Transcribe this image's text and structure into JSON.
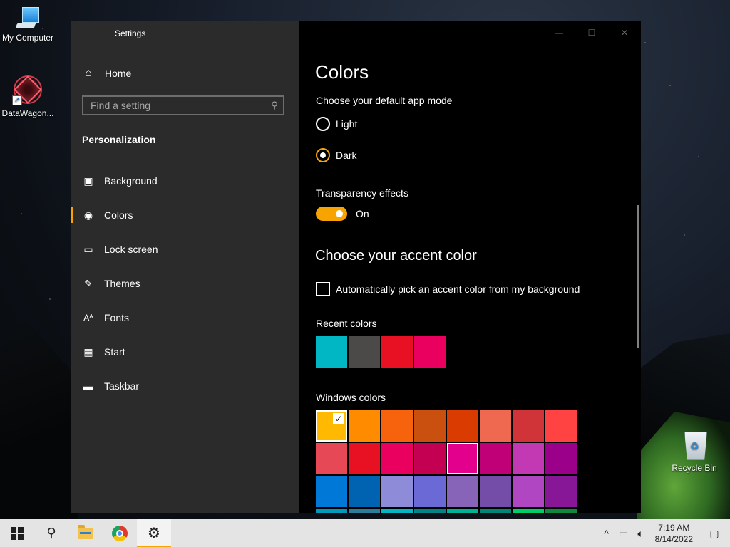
{
  "desktop": {
    "icons": [
      {
        "label": "My Computer"
      },
      {
        "label": "DataWagon..."
      },
      {
        "label": "Recycle Bin"
      }
    ]
  },
  "window": {
    "title": "Settings",
    "controls": {
      "minimize": "—",
      "maximize": "☐",
      "close": "✕"
    }
  },
  "sidebar": {
    "home": {
      "label": "Home",
      "icon": "home-icon"
    },
    "search": {
      "placeholder": "Find a setting",
      "icon": "search-icon"
    },
    "section_title": "Personalization",
    "items": [
      {
        "label": "Background",
        "icon": "picture-icon",
        "active": false
      },
      {
        "label": "Colors",
        "icon": "palette-icon",
        "active": true
      },
      {
        "label": "Lock screen",
        "icon": "lock-screen-icon",
        "active": false
      },
      {
        "label": "Themes",
        "icon": "brush-icon",
        "active": false
      },
      {
        "label": "Fonts",
        "icon": "font-icon",
        "active": false
      },
      {
        "label": "Start",
        "icon": "start-icon",
        "active": false
      },
      {
        "label": "Taskbar",
        "icon": "taskbar-icon",
        "active": false
      }
    ]
  },
  "content": {
    "title": "Colors",
    "app_mode": {
      "heading": "Choose your default app mode",
      "options": [
        {
          "label": "Light",
          "selected": false
        },
        {
          "label": "Dark",
          "selected": true
        }
      ]
    },
    "transparency": {
      "heading": "Transparency effects",
      "state_label": "On",
      "on": true
    },
    "accent": {
      "heading": "Choose your accent color",
      "auto_checkbox_label": "Automatically pick an accent color from my background",
      "auto_checked": false
    },
    "recent_colors": {
      "heading": "Recent colors",
      "colors": [
        "#00b7c3",
        "#4c4a48",
        "#e81123",
        "#ea005e"
      ]
    },
    "windows_colors": {
      "heading": "Windows colors",
      "selected_index": 0,
      "rows": [
        [
          "#ffb900",
          "#ff8c00",
          "#f7630c",
          "#ca5010",
          "#da3b01",
          "#ef6950",
          "#d13438",
          "#ff4343"
        ],
        [
          "#e74856",
          "#e81123",
          "#ea005e",
          "#c30052",
          "#e3008c",
          "#bf0077",
          "#c239b3",
          "#9a0089"
        ],
        [
          "#0078d7",
          "#0063b1",
          "#8e8cd8",
          "#6b69d6",
          "#8764b8",
          "#744da9",
          "#b146c2",
          "#881798"
        ]
      ],
      "partial_row": [
        "#0099bc",
        "#2d7d9a",
        "#00b7c3",
        "#038387",
        "#00b294",
        "#018574",
        "#00cc6a",
        "#10893e"
      ]
    }
  },
  "taskbar": {
    "apps": [
      {
        "name": "start",
        "icon": "windows-start-icon"
      },
      {
        "name": "search",
        "icon": "search-icon"
      },
      {
        "name": "file-explorer",
        "icon": "folder-icon"
      },
      {
        "name": "chrome",
        "icon": "chrome-icon"
      },
      {
        "name": "settings",
        "icon": "gear-icon",
        "active": true
      }
    ],
    "tray": {
      "chevron": "^",
      "time": "7:19 AM",
      "date": "8/14/2022"
    }
  },
  "colors": {
    "accent": "#f7a400",
    "sidebar_bg": "#2b2b2b",
    "content_bg": "#000000",
    "taskbar_bg": "#e4e4e4"
  }
}
